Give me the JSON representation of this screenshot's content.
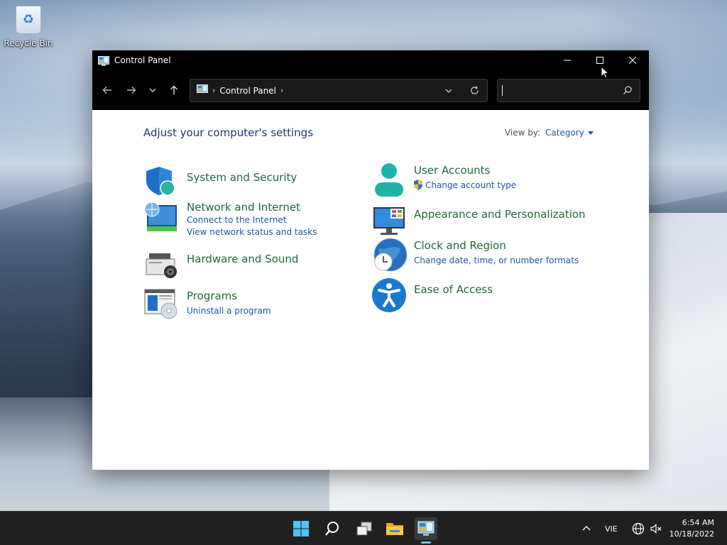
{
  "desktop": {
    "recycle_bin_label": "Recycle Bin"
  },
  "window": {
    "title": "Control Panel",
    "controls": [
      "minimize",
      "maximize",
      "close"
    ],
    "breadcrumb": [
      "Control Panel"
    ],
    "search": {
      "value": "",
      "placeholder": ""
    }
  },
  "content": {
    "heading": "Adjust your computer's settings",
    "view_by_label": "View by:",
    "view_by_value": "Category",
    "categories": [
      {
        "title": "System and Security",
        "icon": "shield-icon",
        "links": []
      },
      {
        "title": "Network and Internet",
        "icon": "network-icon",
        "links": [
          "Connect to the Internet",
          "View network status and tasks"
        ]
      },
      {
        "title": "Hardware and Sound",
        "icon": "printer-icon",
        "links": []
      },
      {
        "title": "Programs",
        "icon": "programs-icon",
        "links": [
          "Uninstall a program"
        ]
      },
      {
        "title": "User Accounts",
        "icon": "user-icon",
        "links": [
          "Change account type"
        ]
      },
      {
        "title": "Appearance and Personalization",
        "icon": "monitor-icon",
        "links": []
      },
      {
        "title": "Clock and Region",
        "icon": "clock-globe-icon",
        "links": [
          "Change date, time, or number formats"
        ]
      },
      {
        "title": "Ease of Access",
        "icon": "accessibility-icon",
        "links": []
      }
    ]
  },
  "taskbar": {
    "apps": [
      "start-icon",
      "search-icon",
      "task-view-icon",
      "file-explorer-icon",
      "control-panel-icon"
    ],
    "language": "VIE",
    "time": "6:54 AM",
    "date": "10/18/2022"
  },
  "colors": {
    "category_title": "#1c6a3a",
    "link": "#1a5aa8",
    "heading": "#1e3a6e",
    "titlebar": "#000000",
    "taskbar": "#202020"
  }
}
